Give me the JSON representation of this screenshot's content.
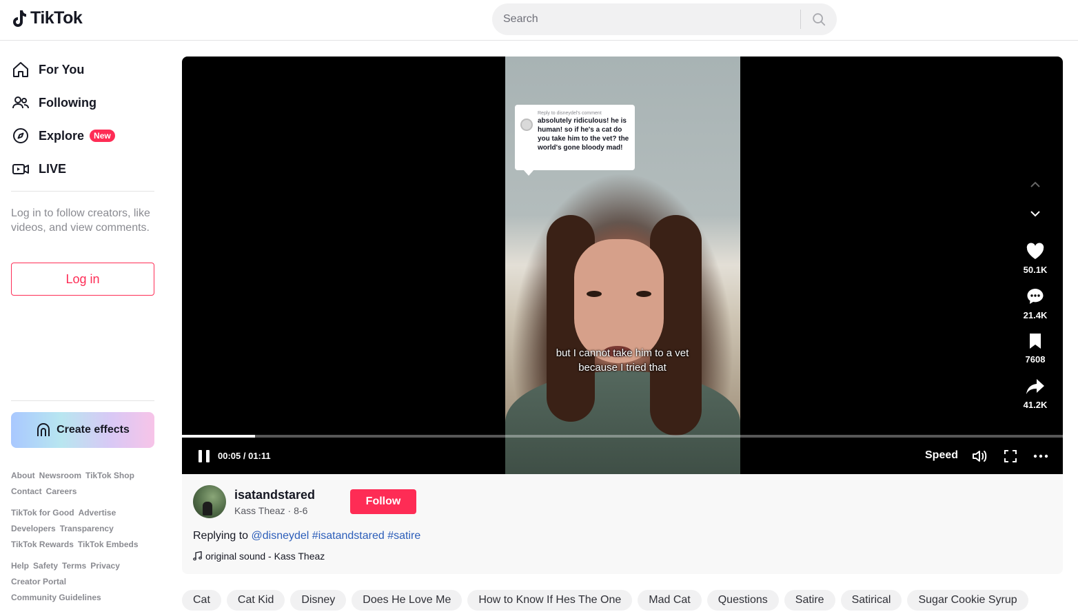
{
  "app": {
    "name": "TikTok"
  },
  "search": {
    "placeholder": "Search"
  },
  "nav": [
    {
      "label": "For You",
      "icon": "home-icon"
    },
    {
      "label": "Following",
      "icon": "users-icon"
    },
    {
      "label": "Explore",
      "icon": "compass-icon",
      "badge": "New"
    },
    {
      "label": "LIVE",
      "icon": "live-video-icon"
    }
  ],
  "login": {
    "message": "Log in to follow creators, like videos, and view comments.",
    "button": "Log in"
  },
  "effects": {
    "label": "Create effects"
  },
  "footer": {
    "row1": [
      "About",
      "Newsroom",
      "TikTok Shop",
      "Contact",
      "Careers"
    ],
    "row2": [
      "TikTok for Good",
      "Advertise",
      "Developers",
      "Transparency",
      "TikTok Rewards",
      "TikTok Embeds"
    ],
    "row3": [
      "Help",
      "Safety",
      "Terms",
      "Privacy",
      "Creator Portal",
      "Community Guidelines"
    ]
  },
  "video": {
    "comment_header": "Reply to disneydel's comment",
    "comment_text": "absolutely ridiculous! he is human! so if he's a cat do you take him to the vet? the world's gone bloody mad!",
    "caption": "but I cannot take him to a vet because I tried that",
    "time": "00:05 / 01:11",
    "progress": 0.083,
    "speed_label": "Speed",
    "likes": "50.1K",
    "comments": "21.4K",
    "saves": "7608",
    "shares": "41.2K"
  },
  "post": {
    "username": "isatandstared",
    "display_name": "Kass Theaz",
    "date": "8-6",
    "follow_label": "Follow",
    "replying_prefix": "Replying to",
    "mention": "@disneydel",
    "hashtags": [
      "#isatandstared",
      "#satire"
    ],
    "sound": "original sound - Kass Theaz"
  },
  "tags": [
    "Cat",
    "Cat Kid",
    "Disney",
    "Does He Love Me",
    "How to Know If Hes The One",
    "Mad Cat",
    "Questions",
    "Satire",
    "Satirical",
    "Sugar Cookie Syrup"
  ],
  "colors": {
    "accent": "#fe2c55",
    "link": "#2b5db9"
  }
}
